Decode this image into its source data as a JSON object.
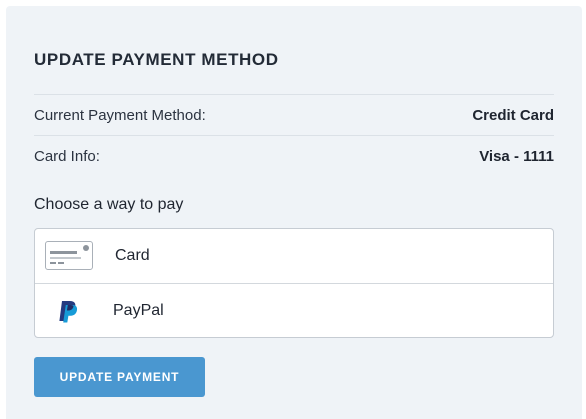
{
  "title": "UPDATE PAYMENT METHOD",
  "details": [
    {
      "label": "Current Payment Method:",
      "value": "Credit Card"
    },
    {
      "label": "Card Info:",
      "value": "Visa - 1111"
    }
  ],
  "choose_label": "Choose a way to pay",
  "options": [
    {
      "label": "Card",
      "icon": "credit-card-icon"
    },
    {
      "label": "PayPal",
      "icon": "paypal-icon"
    }
  ],
  "submit_label": "UPDATE PAYMENT",
  "colors": {
    "panel_bg": "#eff3f7",
    "button_bg": "#4a97d0",
    "paypal_dark": "#253b80",
    "paypal_light": "#179bd7"
  }
}
